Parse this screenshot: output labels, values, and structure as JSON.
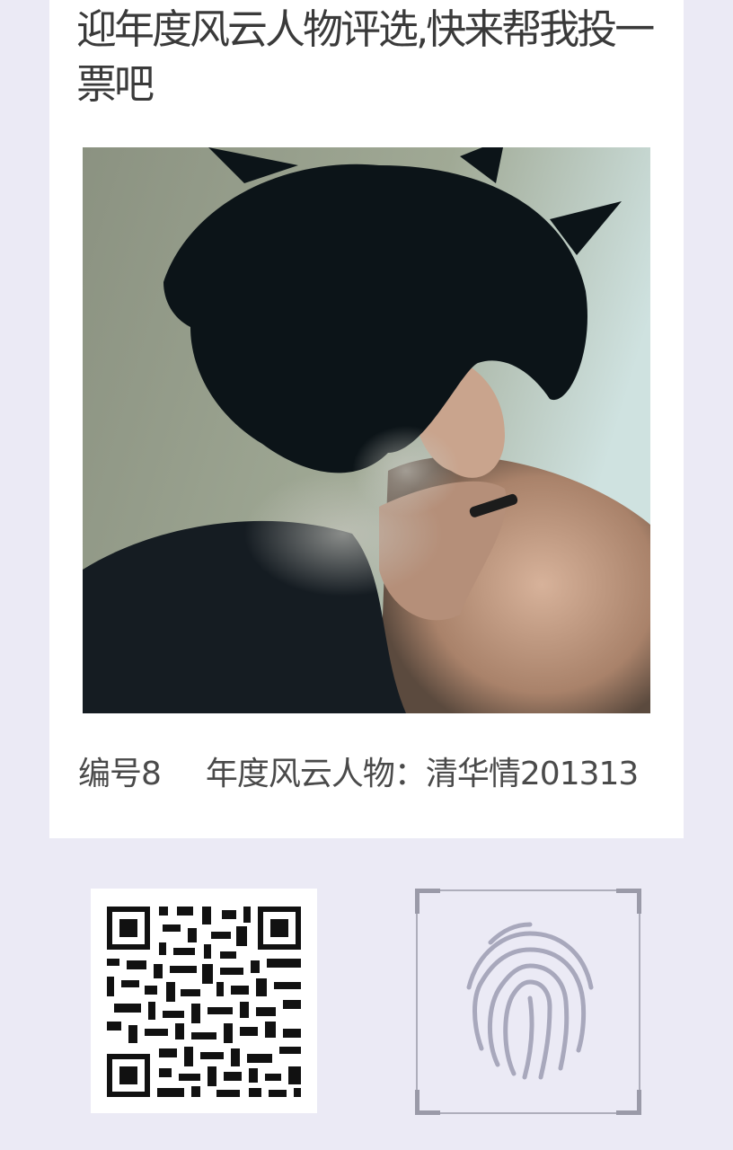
{
  "post": {
    "headline": "迎年度风云人物评选,快来帮我投一票吧",
    "photo": "young-man-smoking-portrait"
  },
  "caption": {
    "number": "编号8",
    "title": "年度风云人物：清华情201313"
  },
  "scan": {
    "qr_icon": "qr-code-icon",
    "fingerprint_icon": "fingerprint-icon"
  },
  "colors": {
    "page_bg": "#ebeaf5",
    "card_bg": "#ffffff",
    "text": "#3a3a3a",
    "frame": "#9a9aa8",
    "fingerprint": "#a8a8bc"
  }
}
